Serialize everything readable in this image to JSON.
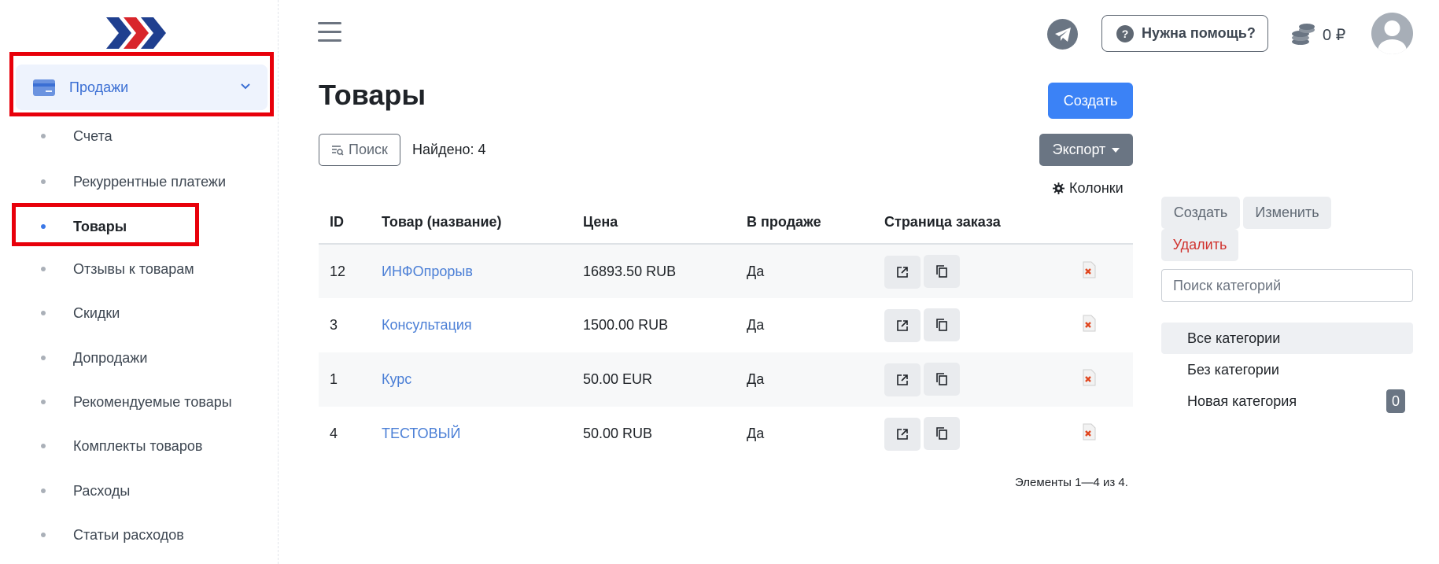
{
  "sidebar": {
    "sales_label": "Продажи",
    "items": [
      {
        "label": "Счета"
      },
      {
        "label": "Рекуррентные платежи"
      },
      {
        "label": "Товары",
        "active": true
      },
      {
        "label": "Отзывы к товарам"
      },
      {
        "label": "Скидки"
      },
      {
        "label": "Допродажи"
      },
      {
        "label": "Рекомендуемые товары"
      },
      {
        "label": "Комплекты товаров"
      },
      {
        "label": "Расходы"
      },
      {
        "label": "Статьи расходов"
      }
    ]
  },
  "header": {
    "help_label": "Нужна помощь?",
    "help_icon": "?",
    "balance": "0 ₽"
  },
  "main": {
    "title": "Товары",
    "create_label": "Создать",
    "search_label": "Поиск",
    "found_text": "Найдено: 4",
    "export_label": "Экспорт",
    "columns_label": "Колонки",
    "table": {
      "headers": [
        "ID",
        "Товар (название)",
        "Цена",
        "В продаже",
        "Страница заказа"
      ],
      "rows": [
        {
          "id": "12",
          "name": "ИНФОпрорыв",
          "price": "16893.50 RUB",
          "on_sale": "Да"
        },
        {
          "id": "3",
          "name": "Консультация",
          "price": "1500.00 RUB",
          "on_sale": "Да"
        },
        {
          "id": "1",
          "name": "Курс",
          "price": "50.00 EUR",
          "on_sale": "Да"
        },
        {
          "id": "4",
          "name": "ТЕСТОВЫЙ",
          "price": "50.00 RUB",
          "on_sale": "Да"
        }
      ]
    },
    "pager_text": "Элементы 1—4 из 4."
  },
  "categories": {
    "create_label": "Создать",
    "edit_label": "Изменить",
    "delete_label": "Удалить",
    "search_placeholder": "Поиск категорий",
    "items": [
      {
        "label": "Все категории",
        "selected": true
      },
      {
        "label": "Без категории"
      },
      {
        "label": "Новая категория",
        "count": "0"
      }
    ]
  },
  "colors": {
    "accent": "#3b82f6",
    "link": "#4b7fd6",
    "highlight_border": "#e8000a",
    "danger": "#d0312d",
    "secondary": "#6a7583"
  }
}
